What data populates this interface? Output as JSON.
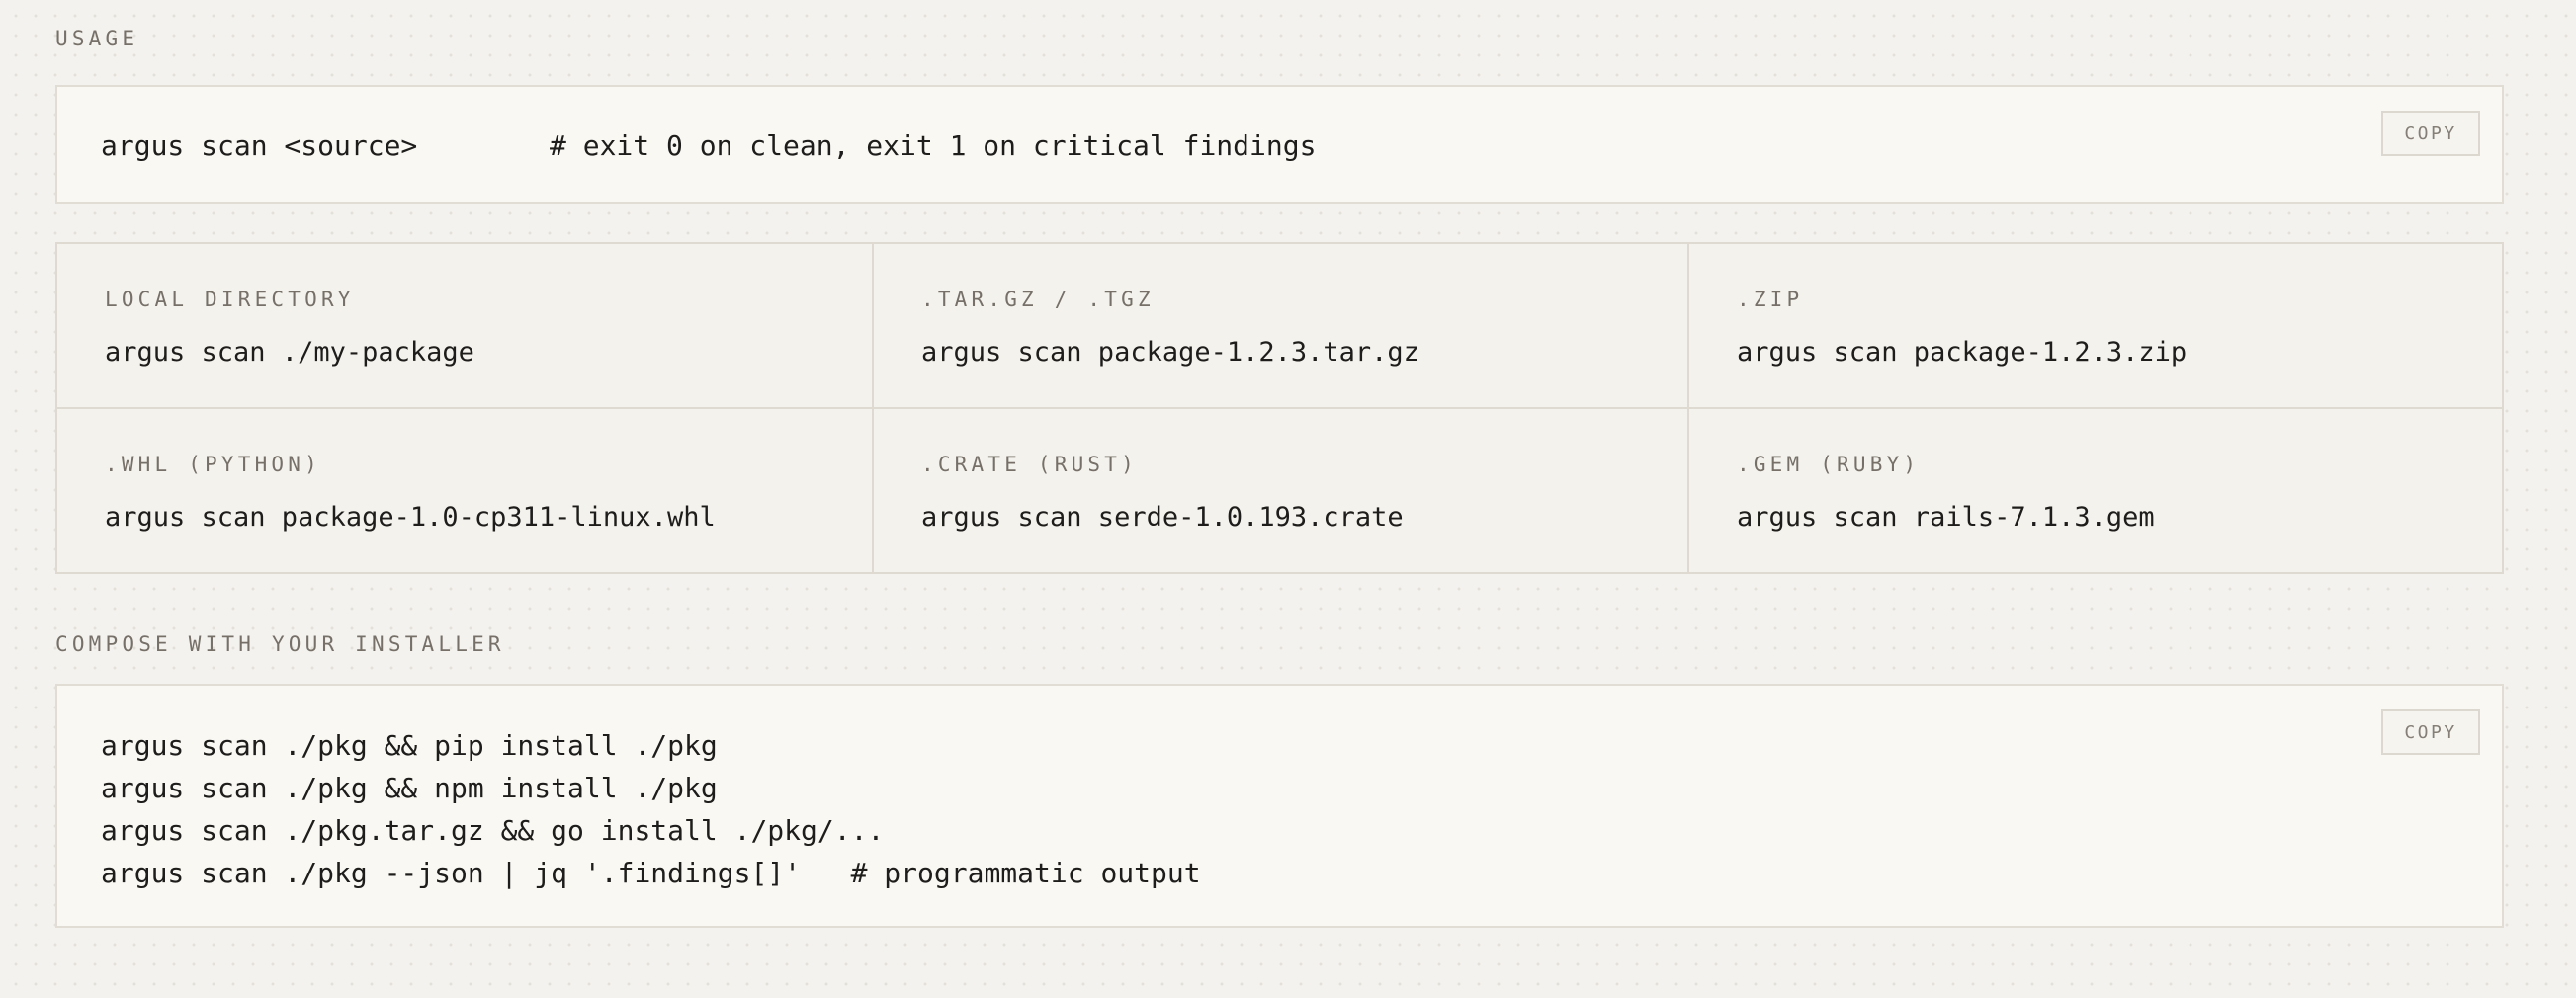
{
  "usage": {
    "label": "USAGE",
    "command": "argus scan <source>",
    "comment": "# exit 0 on clean, exit 1 on critical findings",
    "copy_label": "COPY"
  },
  "sources": [
    {
      "label": "LOCAL DIRECTORY",
      "command": "argus scan ./my-package"
    },
    {
      "label": ".TAR.GZ / .TGZ",
      "command": "argus scan package-1.2.3.tar.gz"
    },
    {
      "label": ".ZIP",
      "command": "argus scan package-1.2.3.zip"
    },
    {
      "label": ".WHL (PYTHON)",
      "command": "argus scan package-1.0-cp311-linux.whl"
    },
    {
      "label": ".CRATE (RUST)",
      "command": "argus scan serde-1.0.193.crate"
    },
    {
      "label": ".GEM (RUBY)",
      "command": "argus scan rails-7.1.3.gem"
    }
  ],
  "compose": {
    "label": "COMPOSE WITH YOUR INSTALLER",
    "lines": [
      "argus scan ./pkg && pip install ./pkg",
      "argus scan ./pkg && npm install ./pkg",
      "argus scan ./pkg.tar.gz && go install ./pkg/...",
      "argus scan ./pkg --json | jq '.findings[]'   # programmatic output"
    ],
    "copy_label": "COPY"
  }
}
